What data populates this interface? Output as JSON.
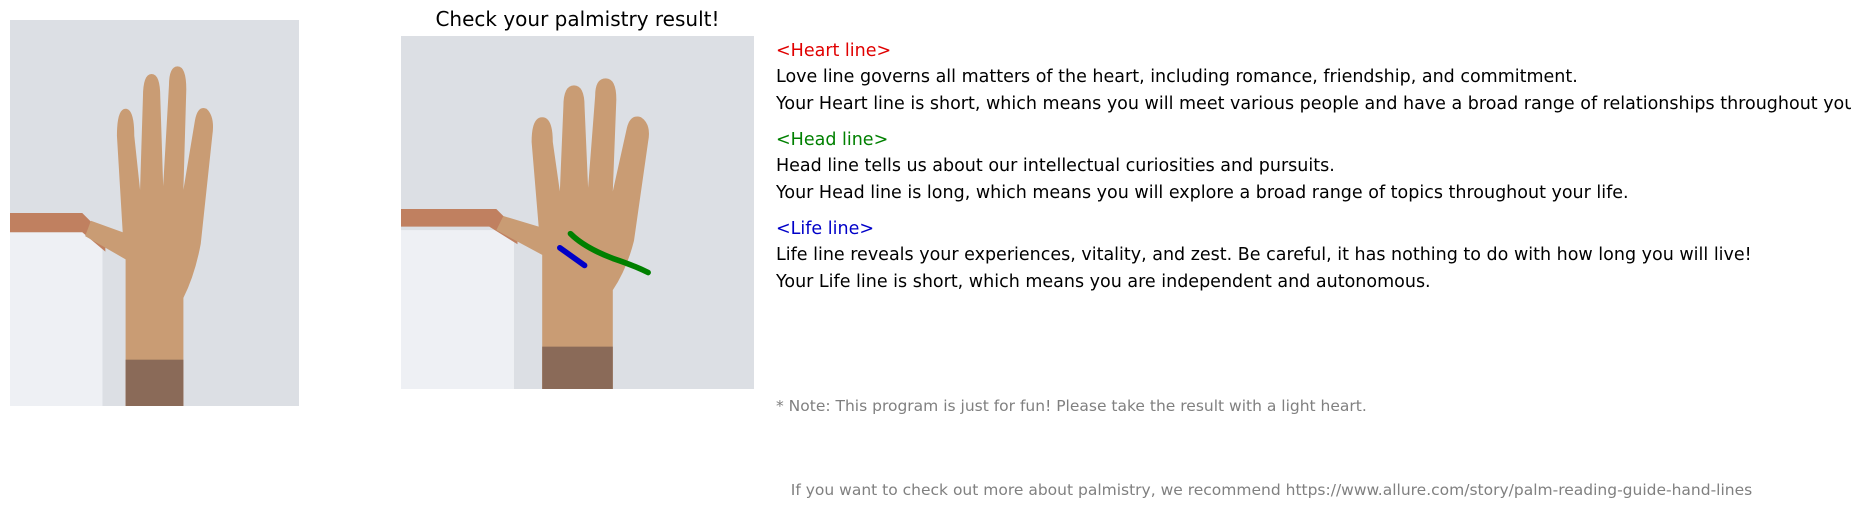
{
  "title": "Check your palmistry result!",
  "sections": [
    {
      "heading": "<Heart line>",
      "color": "#e00000",
      "description": "Love line governs all matters of the heart, including romance, friendship, and commitment.",
      "result": "Your Heart line is short, which means you will meet various people and have a broad range of relationships throughout your life."
    },
    {
      "heading": "<Head line>",
      "color": "#008000",
      "description": "Head line tells us about our intellectual curiosities and pursuits.",
      "result": "Your Head line is long, which means you will explore a broad range of topics throughout your life."
    },
    {
      "heading": "<Life line>",
      "color": "#0000c8",
      "description": "Life line reveals your experiences, vitality, and zest. Be careful, it has nothing to do with how long you will live!",
      "result": "Your Life line is short, which means you are independent and autonomous."
    }
  ],
  "note": {
    "line1": "* Note: This program is just for fun! Please take the result with a light heart.",
    "line2": "   If you want to check out more about palmistry, we recommend https://www.allure.com/story/palm-reading-guide-hand-lines",
    "color": "#808080"
  },
  "images": {
    "left": "original-palm-photo",
    "right": "annotated-palm-photo"
  },
  "palm_line_colors": {
    "heart": "#008000",
    "life": "#0000c8"
  }
}
